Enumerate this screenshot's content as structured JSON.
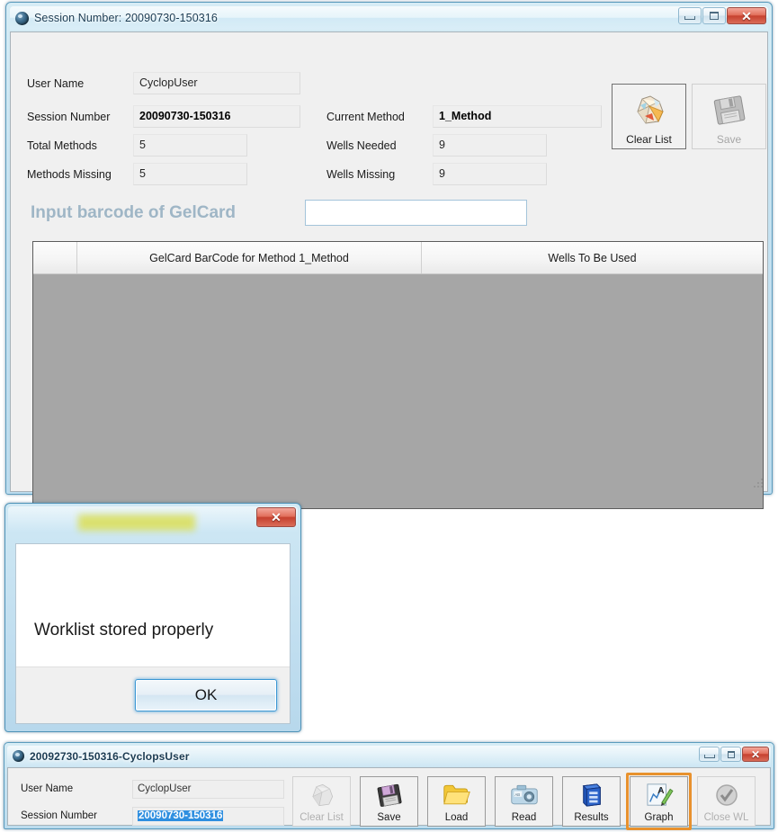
{
  "main_window": {
    "title": "Session Number: 20090730-150316",
    "icon": "app-icon",
    "controls": {
      "minimize": "minimize-icon",
      "maximize": "maximize-icon",
      "close": "close-icon"
    },
    "fields": [
      {
        "label": "User Name",
        "value": "CyclopUser"
      },
      {
        "label": "Session Number",
        "value": "20090730-150316"
      },
      {
        "label": "Total Methods",
        "value": "5"
      },
      {
        "label": "Methods Missing",
        "value": "5"
      },
      {
        "label": "Current Method",
        "value": "1_Method"
      },
      {
        "label": "Wells Needed",
        "value": "9"
      },
      {
        "label": "Wells Missing",
        "value": "9"
      }
    ],
    "buttons": [
      {
        "label": "Clear List",
        "icon": "crumpled-paper-icon",
        "enabled": true
      },
      {
        "label": "Save",
        "icon": "floppy-disk-icon",
        "enabled": false
      }
    ],
    "barcode": {
      "label": "Input barcode of GelCard",
      "value": "",
      "placeholder": ""
    },
    "grid": {
      "columns": [
        "",
        "GelCard BarCode for Method  1_Method",
        "Wells To Be Used"
      ],
      "rows": []
    }
  },
  "dialog": {
    "title": "",
    "message": "Worklist stored properly",
    "ok_label": "OK",
    "close_icon": "close-icon"
  },
  "bottom_window": {
    "title": "20092730-150316-CyclopsUser",
    "controls": {
      "minimize": "minimize-icon",
      "maximize": "maximize-icon",
      "close": "close-icon"
    },
    "fields": [
      {
        "label": "User Name",
        "value": "CyclopUser",
        "selected": false
      },
      {
        "label": "Session Number",
        "value": "20090730-150316",
        "selected": true
      }
    ],
    "buttons": [
      {
        "label": "Clear List",
        "icon": "crumpled-paper-icon",
        "enabled": false,
        "highlighted": false
      },
      {
        "label": "Save",
        "icon": "floppy-disk-icon",
        "enabled": true,
        "highlighted": false
      },
      {
        "label": "Load",
        "icon": "open-folder-icon",
        "enabled": true,
        "highlighted": false
      },
      {
        "label": "Read",
        "icon": "camera-icon",
        "enabled": true,
        "highlighted": false
      },
      {
        "label": "Results",
        "icon": "database-icon",
        "enabled": true,
        "highlighted": false
      },
      {
        "label": "Graph",
        "icon": "chart-pen-icon",
        "enabled": true,
        "highlighted": true
      },
      {
        "label": "Close WL",
        "icon": "check-circle-icon",
        "enabled": false,
        "highlighted": false
      }
    ]
  },
  "colors": {
    "accent_orange": "#e8912d",
    "selection_blue": "#2f8fe0",
    "barcode_label": "#9fb6c6",
    "grid_body": "#a6a6a6",
    "titlebar_close": "#c6412f"
  }
}
